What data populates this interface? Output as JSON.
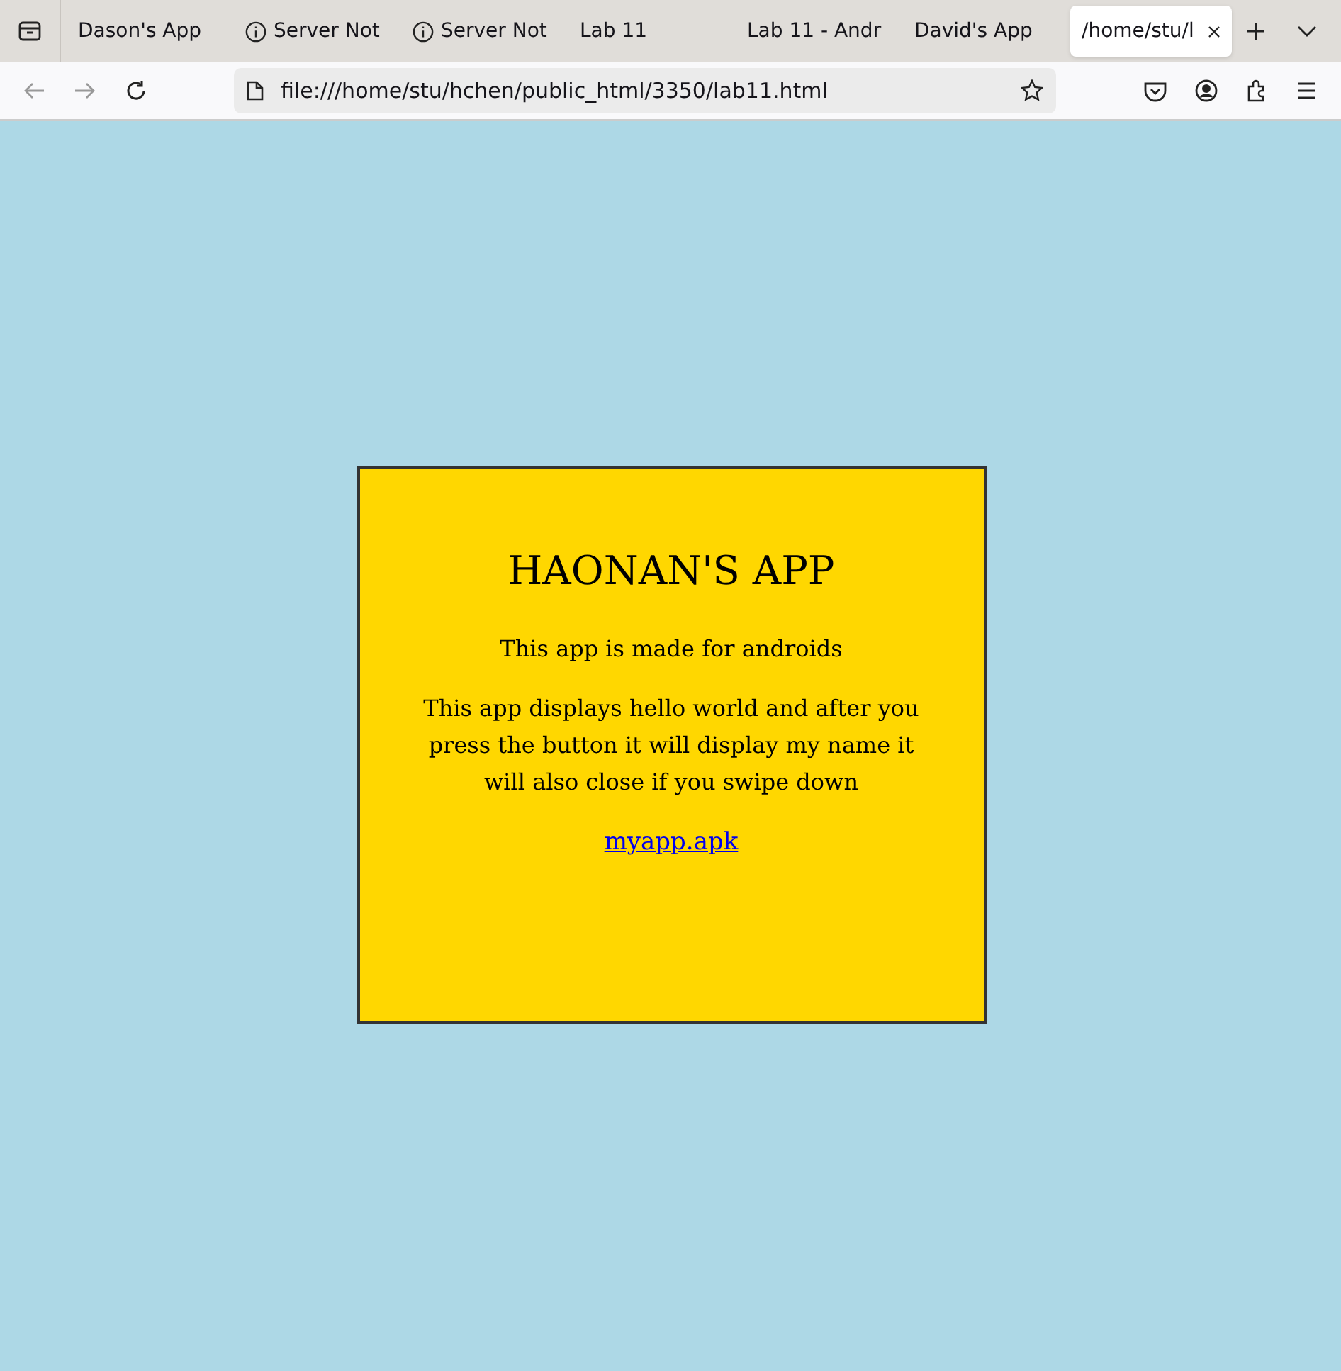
{
  "tabs": [
    {
      "label": "Dason's App",
      "kind": "page",
      "selected": false
    },
    {
      "label": "Server Not",
      "kind": "error",
      "selected": false
    },
    {
      "label": "Server Not",
      "kind": "error",
      "selected": false
    },
    {
      "label": "Lab 11",
      "kind": "page",
      "selected": false
    },
    {
      "label": "Lab 11 - Andr",
      "kind": "page",
      "selected": false
    },
    {
      "label": "David's App",
      "kind": "page",
      "selected": false
    },
    {
      "label": "/home/stu/l",
      "kind": "page",
      "selected": true
    }
  ],
  "address_bar": {
    "url": "file:///home/stu/hchen/public_html/3350/lab11.html"
  },
  "page": {
    "title": "HAONAN'S APP",
    "paragraphs": [
      "This app is made for androids",
      "This app displays hello world and after you press the button it will display my name it will also close if you swipe down"
    ],
    "link": "myapp.apk"
  }
}
